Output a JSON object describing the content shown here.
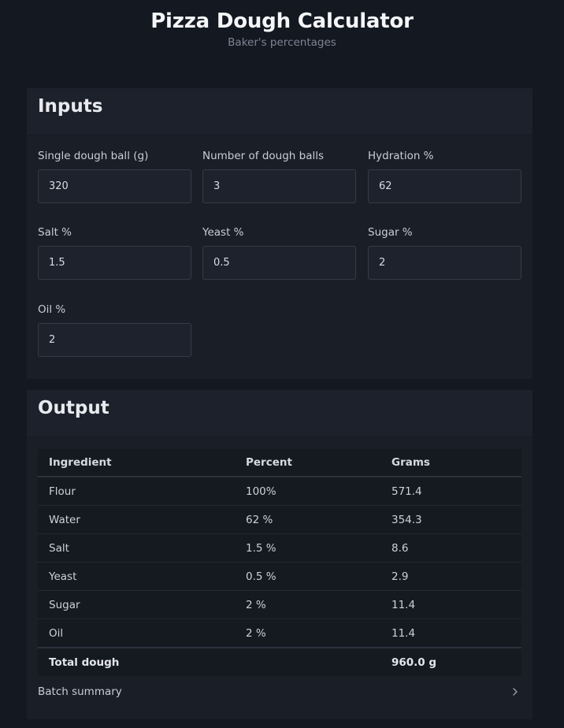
{
  "header": {
    "title": "Pizza Dough Calculator",
    "subtitle": "Baker's percentages"
  },
  "inputs": {
    "title": "Inputs",
    "fields": [
      {
        "label": "Single dough ball (g)",
        "value": "320"
      },
      {
        "label": "Number of dough balls",
        "value": "3"
      },
      {
        "label": "Hydration %",
        "value": "62"
      },
      {
        "label": "Salt %",
        "value": "1.5"
      },
      {
        "label": "Yeast %",
        "value": "0.5"
      },
      {
        "label": "Sugar %",
        "value": "2"
      },
      {
        "label": "Oil %",
        "value": "2"
      }
    ]
  },
  "output": {
    "title": "Output",
    "columns": [
      "Ingredient",
      "Percent",
      "Grams"
    ],
    "rows": [
      {
        "ingredient": "Flour",
        "percent": "100%",
        "grams": "571.4"
      },
      {
        "ingredient": "Water",
        "percent": "62 %",
        "grams": "354.3"
      },
      {
        "ingredient": "Salt",
        "percent": "1.5 %",
        "grams": "8.6"
      },
      {
        "ingredient": "Yeast",
        "percent": "0.5 %",
        "grams": "2.9"
      },
      {
        "ingredient": "Sugar",
        "percent": "2 %",
        "grams": "11.4"
      },
      {
        "ingredient": "Oil",
        "percent": "2 %",
        "grams": "11.4"
      }
    ],
    "total_label": "Total dough",
    "total_value": "960.0 g",
    "summary_label": "Batch summary",
    "summary_icon": "chevron-right-icon"
  }
}
